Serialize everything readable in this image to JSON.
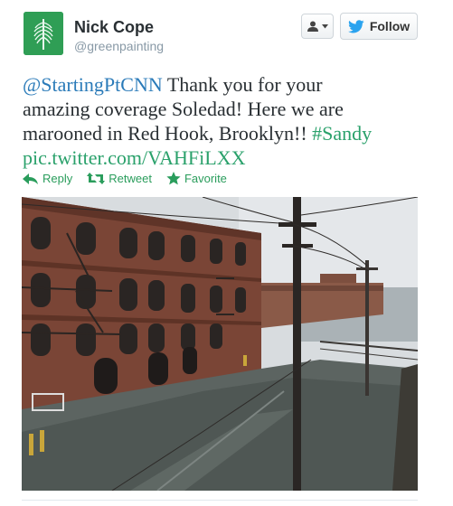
{
  "author": {
    "name": "Nick Cope",
    "handle": "@greenpainting"
  },
  "buttons": {
    "follow_label": "Follow"
  },
  "tweet": {
    "mention": "@StartingPtCNN",
    "text_line1_rest": " Thank you for your",
    "text_line2": "amazing coverage Soledad! Here we are",
    "text_line3_start": "marooned in Red Hook, Brooklyn!! ",
    "hashtag": "#Sandy",
    "link": "pic.twitter.com/VAHFiLXX"
  },
  "actions": {
    "reply": "Reply",
    "retweet": "Retweet",
    "favorite": "Favorite"
  },
  "colors": {
    "link": "#2b7bb9",
    "action_green": "#2a9d5c",
    "avatar_green": "#2f9e55",
    "follow_bird": "#2aa3ef"
  },
  "icons": {
    "user_menu": "user-dropdown-icon",
    "follow": "twitter-bird-icon",
    "reply": "reply-arrow-icon",
    "retweet": "retweet-icon",
    "favorite": "star-icon"
  }
}
